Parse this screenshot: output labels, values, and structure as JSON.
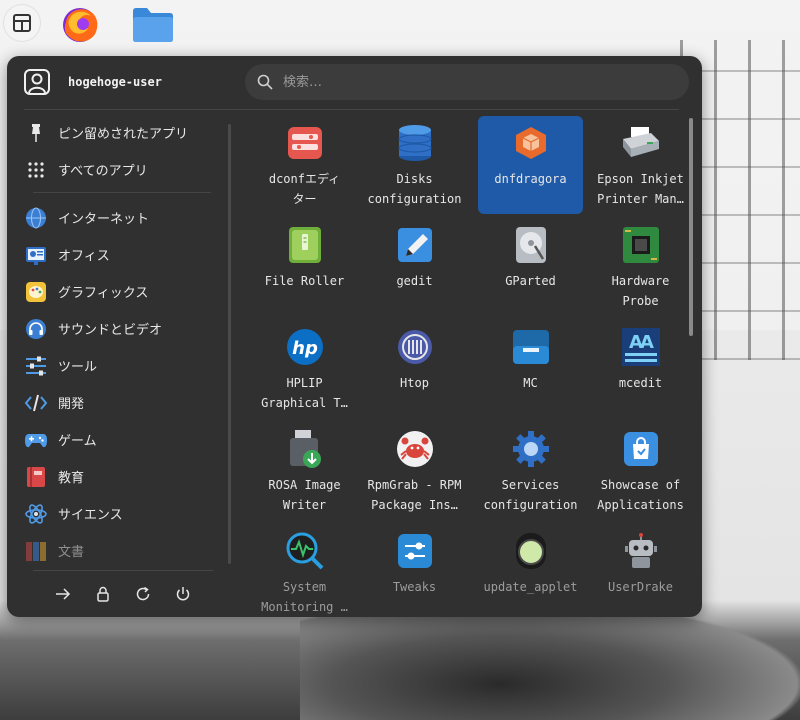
{
  "user": {
    "name": "hogehoge-user"
  },
  "search": {
    "placeholder": "検索…"
  },
  "sidebar": {
    "pinned_label": "ピン留めされたアプリ",
    "all_label": "すべてのアプリ",
    "categories": [
      {
        "label": "インターネット",
        "icon": "globe-icon"
      },
      {
        "label": "オフィス",
        "icon": "office-icon"
      },
      {
        "label": "グラフィックス",
        "icon": "palette-icon"
      },
      {
        "label": "サウンドとビデオ",
        "icon": "headphones-icon"
      },
      {
        "label": "ツール",
        "icon": "sliders-icon"
      },
      {
        "label": "開発",
        "icon": "code-icon"
      },
      {
        "label": "ゲーム",
        "icon": "gamepad-icon"
      },
      {
        "label": "教育",
        "icon": "book-icon"
      },
      {
        "label": "サイエンス",
        "icon": "atom-icon"
      },
      {
        "label": "文書",
        "icon": "books-icon"
      }
    ]
  },
  "actions": [
    {
      "name": "logout-icon"
    },
    {
      "name": "lock-icon"
    },
    {
      "name": "restart-icon"
    },
    {
      "name": "power-icon"
    }
  ],
  "apps": [
    {
      "label": "dconfエディ\nター",
      "icon": "dconf-icon",
      "selected": false
    },
    {
      "label": "Disks\nconfiguration",
      "icon": "disks-icon",
      "selected": false
    },
    {
      "label": "dnfdragora",
      "icon": "package-icon",
      "selected": true
    },
    {
      "label": "Epson Inkjet\nPrinter Man…",
      "icon": "printer-icon",
      "selected": false
    },
    {
      "label": "File Roller",
      "icon": "archive-icon",
      "selected": false
    },
    {
      "label": "gedit",
      "icon": "text-editor-icon",
      "selected": false
    },
    {
      "label": "GParted",
      "icon": "disk-partition-icon",
      "selected": false
    },
    {
      "label": "Hardware\nProbe",
      "icon": "circuit-board-icon",
      "selected": false
    },
    {
      "label": "HPLIP\nGraphical T…",
      "icon": "hp-icon",
      "selected": false
    },
    {
      "label": "Htop",
      "icon": "htop-icon",
      "selected": false
    },
    {
      "label": "MC",
      "icon": "midnight-commander-icon",
      "selected": false
    },
    {
      "label": "mcedit",
      "icon": "mcedit-icon",
      "selected": false
    },
    {
      "label": "ROSA Image\nWriter",
      "icon": "usb-writer-icon",
      "selected": false
    },
    {
      "label": "RpmGrab - RPM\nPackage Ins…",
      "icon": "crab-icon",
      "selected": false
    },
    {
      "label": "Services\nconfiguration",
      "icon": "services-gear-icon",
      "selected": false
    },
    {
      "label": "Showcase of\nApplications",
      "icon": "shopping-bag-icon",
      "selected": false
    },
    {
      "label": "System\nMonitoring …",
      "icon": "system-monitor-icon",
      "selected": false
    },
    {
      "label": "Tweaks",
      "icon": "tweaks-icon",
      "selected": false
    },
    {
      "label": "update_applet",
      "icon": "update-applet-icon",
      "selected": false
    },
    {
      "label": "UserDrake",
      "icon": "robot-icon",
      "selected": false
    }
  ],
  "colors": {
    "menu_bg": "#303030",
    "selected_tile": "#1e5aa8",
    "accent_blue": "#3b8fe0"
  }
}
